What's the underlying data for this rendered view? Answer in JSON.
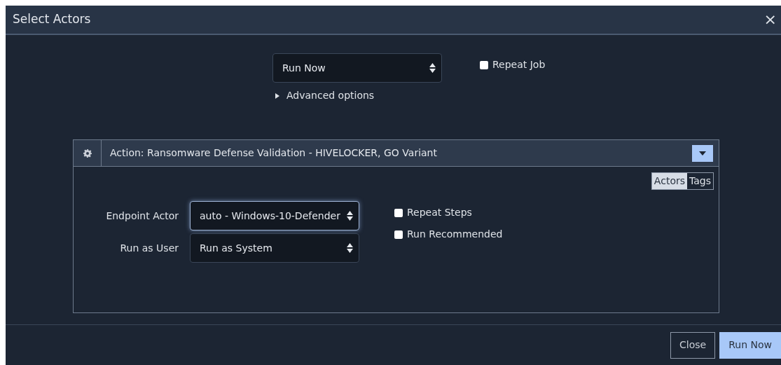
{
  "window": {
    "title": "Select Actors",
    "close": "×"
  },
  "schedule": {
    "value": "Run Now",
    "repeat_job": {
      "label": "Repeat Job",
      "checked": false
    }
  },
  "advanced_options": {
    "label": "Advanced options",
    "expanded": false
  },
  "action": {
    "title": "Action: Ransomware Defense Validation - HIVELOCKER, GO Variant",
    "tabs": [
      {
        "label": "Actors",
        "selected": true
      },
      {
        "label": "Tags",
        "selected": false
      }
    ],
    "fields": [
      {
        "label": "Endpoint Actor",
        "value": "auto - Windows-10-Defender",
        "focused": true
      },
      {
        "label": "Run as User",
        "value": "Run as System",
        "focused": false
      }
    ],
    "options": [
      {
        "label": "Repeat Steps",
        "checked": false
      },
      {
        "label": "Run Recommended",
        "checked": false
      }
    ]
  },
  "buttons": [
    {
      "label": "Close",
      "kind": "secondary"
    },
    {
      "label": "Run Now",
      "kind": "primary"
    }
  ]
}
